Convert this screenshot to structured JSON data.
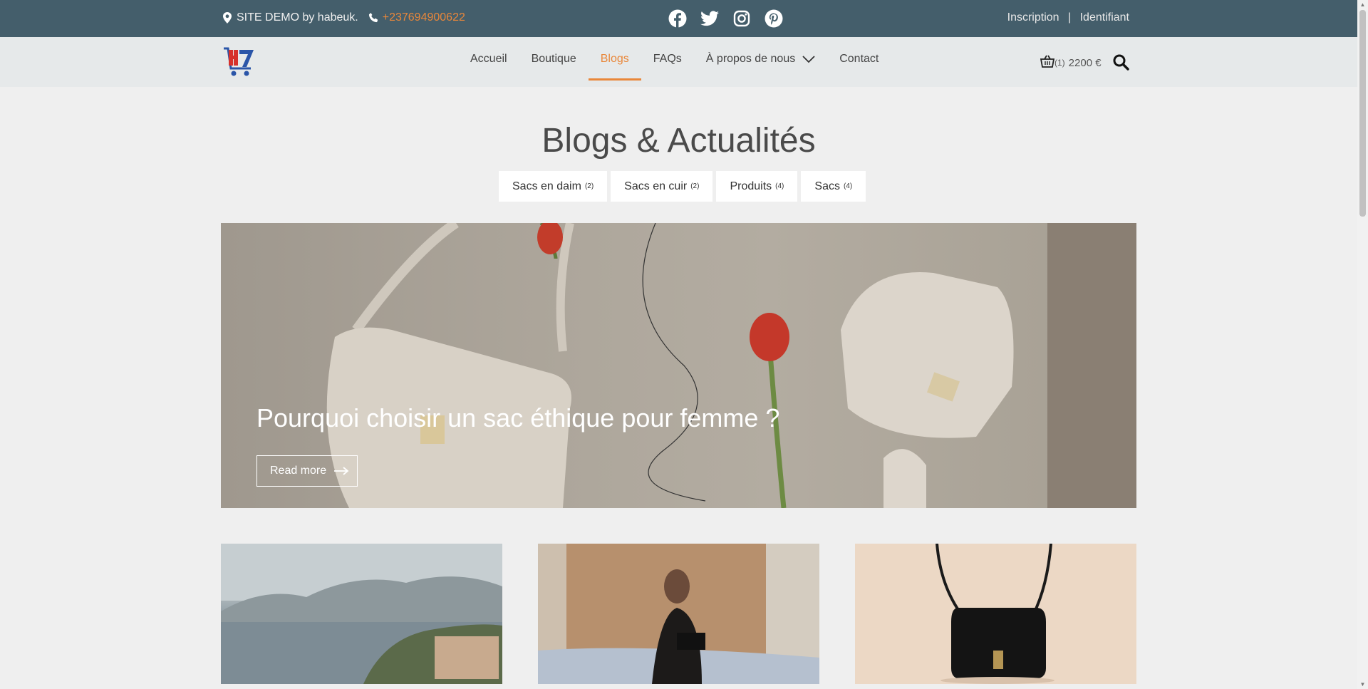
{
  "topbar": {
    "site_text": "SITE DEMO by habeuk.",
    "phone": "+237694900622",
    "social": [
      "facebook-icon",
      "twitter-icon",
      "instagram-icon",
      "pinterest-icon"
    ],
    "register": "Inscription",
    "separator": "|",
    "login": "Identifiant"
  },
  "nav": {
    "items": [
      {
        "label": "Accueil"
      },
      {
        "label": "Boutique"
      },
      {
        "label": "Blogs"
      },
      {
        "label": "FAQs"
      },
      {
        "label": "À propos de nous"
      },
      {
        "label": "Contact"
      }
    ],
    "active": "Blogs"
  },
  "cart": {
    "count": "(1)",
    "total": "2200 €"
  },
  "page": {
    "title": "Blogs & Actualités"
  },
  "categories": [
    {
      "label": "Sacs en daim",
      "count": "(2)"
    },
    {
      "label": "Sacs en cuir",
      "count": "(2)"
    },
    {
      "label": "Produits",
      "count": "(4)"
    },
    {
      "label": "Sacs",
      "count": "(4)"
    }
  ],
  "hero": {
    "title": "Pourquoi choisir un sac éthique pour femme ?",
    "button": "Read more"
  },
  "colors": {
    "topbar": "#445e6b",
    "accent": "#e9873a",
    "navbar": "#e6e9ea",
    "background": "#efefef"
  }
}
